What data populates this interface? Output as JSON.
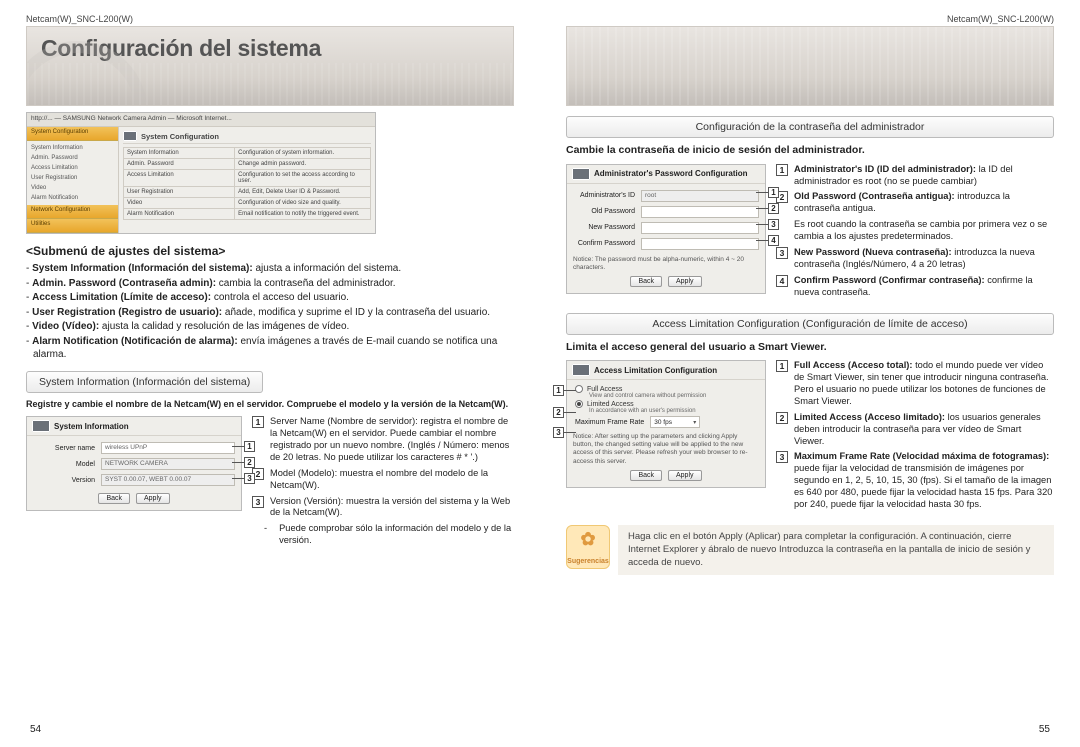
{
  "hdr_left": "Netcam(W)_SNC-L200(W)",
  "hdr_right": "Netcam(W)_SNC-L200(W)",
  "page_left": "54",
  "page_right": "55",
  "hero_title": "Configuración del sistema",
  "shot": {
    "titlebar": "http://... — SAMSUNG Network Camera Admin — Microsoft Internet...",
    "side_band1": "System Configuration",
    "side_items1": [
      "System Information",
      "Admin. Password",
      "Access Limitation",
      "User Registration",
      "Video",
      "Alarm Notification"
    ],
    "side_band2": "Network Configuration",
    "side_band3": "Utilities",
    "panel_title": "System Configuration",
    "rows": [
      [
        "System Information",
        "Configuration of system information."
      ],
      [
        "Admin. Password",
        "Change admin password."
      ],
      [
        "Access Limitation",
        "Configuration to set the access according to user."
      ],
      [
        "User Registration",
        "Add, Edit, Delete User ID & Password."
      ],
      [
        "Video",
        "Configuration of video size and quality."
      ],
      [
        "Alarm Notification",
        "Email notification to notify the triggered event."
      ]
    ]
  },
  "sub_title": "<Submenú de ajustes del sistema>",
  "sub_items": [
    {
      "b": "System Information (Información del sistema):",
      "t": " ajusta a información del sistema."
    },
    {
      "b": "Admin. Password (Contraseña admin):",
      "t": " cambia la contraseña del administrador."
    },
    {
      "b": "Access Limitation (Límite de acceso):",
      "t": " controla el acceso del usuario."
    },
    {
      "b": "User Registration (Registro de usuario):",
      "t": " añade, modifica y suprime el ID y la contraseña del usuario."
    },
    {
      "b": "Video (Vídeo):",
      "t": " ajusta la calidad y resolución de las imágenes de vídeo."
    },
    {
      "b": "Alarm Notification (Notificación de alarma):",
      "t": " envía imágenes a través de E-mail cuando se notifica una alarma."
    }
  ],
  "pill_sysinfo": "System Information (Información del sistema)",
  "sysinfo_note": "Registre y cambie el nombre de la Netcam(W) en el servidor. Compruebe el modelo y la versión de la Netcam(W).",
  "sysinfo_panel": {
    "title": "System Information",
    "labels": {
      "server": "Server name",
      "model": "Model",
      "version": "Version"
    },
    "values": {
      "server": "wireless UPnP",
      "model": "NETWORK CAMERA",
      "version": "SYST 0.00.07, WEBT 0.00.07"
    },
    "btn_back": "Back",
    "btn_apply": "Apply"
  },
  "sysinfo_rhs": [
    {
      "n": "1",
      "head": "Server Name (Nombre de servidor):",
      "body": "registra el nombre de la Netcam(W) en el servidor. Puede cambiar el nombre registrado por un nuevo nombre. (Inglés / Número: menos de 20 letras. No puede utilizar los caracteres # * '.)"
    },
    {
      "n": "2",
      "head": "Model (Modelo):",
      "body": "muestra el nombre del modelo de la Netcam(W)."
    },
    {
      "n": "3",
      "head": "Version (Versión):",
      "body": "muestra la versión del sistema y la Web de la Netcam(W)."
    }
  ],
  "sysinfo_sub": "Puede comprobar sólo la información del modelo y de la versión.",
  "pill_admin": "Configuración de la contraseña del administrador",
  "admin_lead": "Cambie la contraseña de inicio de sesión del administrador.",
  "admin_panel": {
    "title": "Administrator's Password Configuration",
    "labels": {
      "id": "Administrator's ID",
      "old": "Old Password",
      "new": "New Password",
      "conf": "Confirm Password"
    },
    "values": {
      "id": "root"
    },
    "notice": "Notice: The password must be alpha-numeric, within 4 ~ 20 characters.",
    "btn_back": "Back",
    "btn_apply": "Apply"
  },
  "admin_rhs": [
    {
      "n": "1",
      "head": "Administrator's ID (ID del administrador):",
      "body": "la ID del administrador es root  (no se puede cambiar)"
    },
    {
      "n": "2",
      "head": "Old Password (Contraseña antigua):",
      "body": "introduzca la contraseña antigua."
    },
    {
      "n": "",
      "head": "",
      "body": "Es root cuando la contraseña se cambia por primera vez o se cambia a los ajustes predeterminados."
    },
    {
      "n": "3",
      "head": "New Password (Nueva contraseña):",
      "body": "introduzca la nueva contraseña (Inglés/Número, 4 a 20 letras)"
    },
    {
      "n": "4",
      "head": "Confirm Password (Confirmar contraseña):",
      "body": "confirme la nueva contraseña."
    }
  ],
  "pill_access": "Access Limitation Configuration (Configuración de límite de acceso)",
  "access_lead": "Limita el acceso general del usuario a Smart Viewer.",
  "access_panel": {
    "title": "Access Limitation Configuration",
    "opt_full": "Full Access",
    "opt_full_sub": "View and control camera without permission",
    "opt_lim": "Limited Access",
    "opt_lim_sub": "In accordance with an user's permission",
    "rate_label": "Maximum Frame Rate",
    "rate_val": "30 fps",
    "notice": "Notice: After setting up the parameters and clicking Apply button, the changed setting value will be applied to the new access of this server. Please refresh your web browser to re-access this server.",
    "btn_back": "Back",
    "btn_apply": "Apply"
  },
  "access_rhs": [
    {
      "n": "1",
      "head": "Full Access (Acceso total):",
      "body": "todo el mundo puede ver vídeo de Smart Viewer, sin tener que introducir ninguna contraseña. Pero el usuario no puede utilizar los botones de funciones de Smart Viewer."
    },
    {
      "n": "2",
      "head": "Limited Access (Acceso limitado):",
      "body": "los usuarios generales deben introducir la contraseña para ver vídeo de Smart Viewer."
    },
    {
      "n": "3",
      "head": "Maximum Frame Rate (Velocidad máxima de fotogramas):",
      "body": "puede fijar la velocidad de transmisión de imágenes por segundo en 1, 2, 5, 10, 15, 30 (fps). Si el tamaño de la imagen es 640 por 480, puede fijar la velocidad hasta 15 fps. Para 320 por 240, puede fijar la velocidad hasta 30 fps."
    }
  ],
  "tip_label": "Sugerencias",
  "tip_text": "Haga clic en el botón Apply (Aplicar) para completar la configuración. A continuación, cierre Internet Explorer y ábralo de nuevo Introduzca la contraseña en la pantalla de inicio de sesión y acceda de nuevo."
}
